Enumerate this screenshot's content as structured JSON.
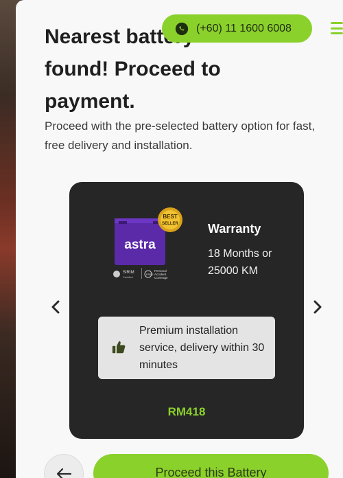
{
  "header": {
    "headline": "Nearest battery found! Proceed to payment.",
    "subtext": "Proceed with the pre-selected battery option for fast, free delivery and installation.",
    "whatsapp_number": "(+60) 11 1600 6008"
  },
  "product": {
    "brand": "astra",
    "badge": "BEST SELLER",
    "certifications": [
      "SIRIM Certified",
      "FREE Personal Accident Coverage"
    ],
    "warranty_title": "Warranty",
    "warranty_detail": "18 Months or 25000 KM",
    "install_text": "Premium installation service, delivery within 30 minutes",
    "price": "RM418"
  },
  "actions": {
    "proceed_label": "Proceed this Battery"
  },
  "colors": {
    "accent": "#8bd12c",
    "card": "#262626",
    "panel": "#f8f8f8"
  }
}
